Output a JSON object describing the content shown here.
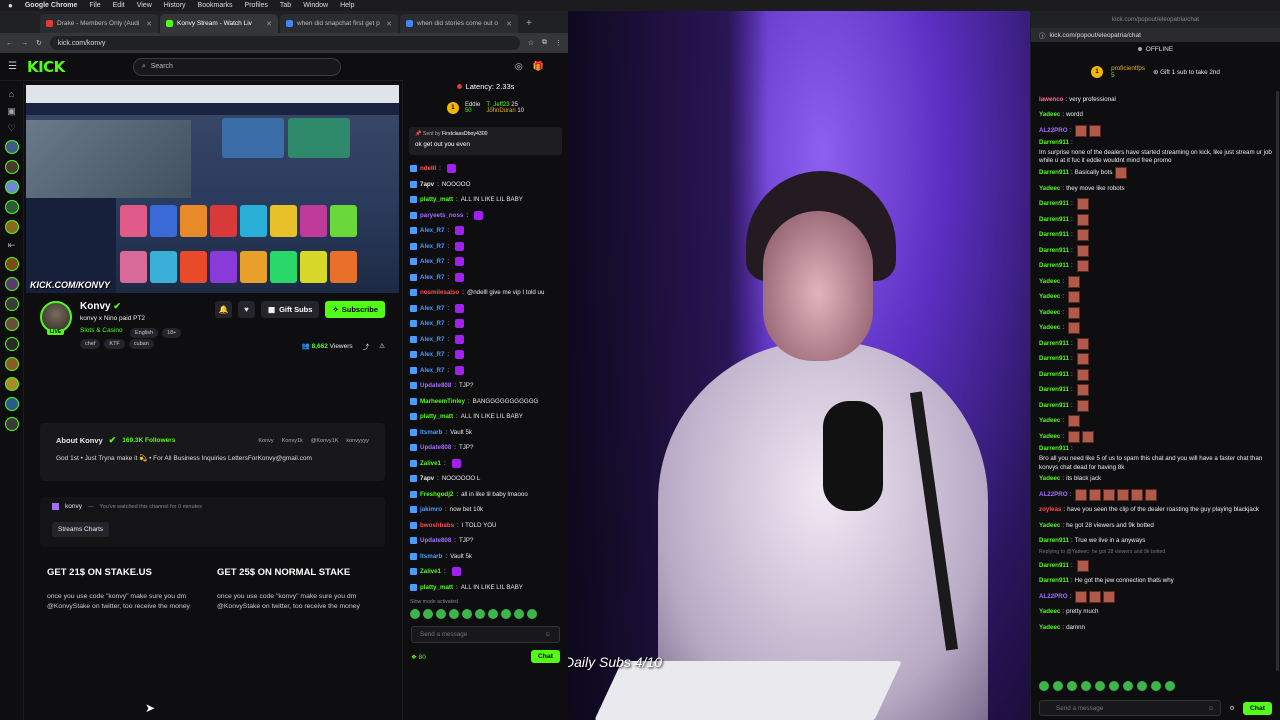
{
  "menubar": {
    "apple": "",
    "app": "Google Chrome",
    "items": [
      "File",
      "Edit",
      "View",
      "History",
      "Bookmarks",
      "Profiles",
      "Tab",
      "Window",
      "Help"
    ]
  },
  "tabs": [
    {
      "label": "Drake - Members Only (Audi",
      "color": "#e53935",
      "active": false
    },
    {
      "label": "Konvy Stream - Watch Liv",
      "color": "#53fc18",
      "active": true
    },
    {
      "label": "when did snapchat first get p",
      "color": "#4285f4",
      "active": false
    },
    {
      "label": "when did stories come out o",
      "color": "#4285f4",
      "active": false
    }
  ],
  "new_tab": "+",
  "url": "kick.com/konvy",
  "site": {
    "logo": "KICK",
    "logo_badge": "BETA",
    "search_placeholder": "Search",
    "player_watermark": "KICK.COM/KONVY",
    "channel": {
      "name": "Konvy",
      "title": "konvy x Nino paid PT2",
      "category": "Slots & Casino",
      "tags": [
        "English",
        "18+",
        "chef",
        "KTF",
        "cuban"
      ],
      "live": "LIVE",
      "gift_label": "Gift Subs",
      "subscribe_label": "Subscribe",
      "viewers_count": "8,662",
      "viewers_label": "Viewers"
    },
    "about": {
      "heading": "About Konvy",
      "followers": "169.3K Followers",
      "socials": [
        "Konvy",
        "Konvy1k",
        "@Konvy1K",
        "konvyyyy"
      ],
      "bio": "God 1st • Just Tryna make it 💫 • For All Business Inquiries LettersForKonvy@gmail.com"
    },
    "watched": {
      "name": "konvy",
      "dash": "—",
      "note": "You've watched this channel for 0 minutes",
      "button": "Streams Charts"
    },
    "promos": [
      {
        "title": "GET 21$ ON STAKE.US",
        "body": "once you use code \"konvy\" make sure you dm @KonvyStake on twitter, too receive the money"
      },
      {
        "title": "GET 25$ ON NORMAL STAKE",
        "body": "once you use code \"konvy\" make sure you dm @KonvyStake on twitter, too receive the money"
      }
    ]
  },
  "left_chat": {
    "latency": "Latency: 2.33s",
    "leaders": [
      {
        "name": "Eddie",
        "value": "50"
      },
      {
        "name": "T_Jeff23",
        "value": "25"
      },
      {
        "name": "JohnDuran",
        "value": "10"
      }
    ],
    "pinned_by": "Sent by",
    "pinned_user": "FirstclassDboy4300",
    "pinned_msg": "ok get out you even",
    "lines": [
      {
        "user": "ndelll",
        "color": "#ff5a5a",
        "text": "",
        "emote": true
      },
      {
        "user": "7apv",
        "color": "#e8e8e8",
        "text": "NOOOOO",
        "emote": false
      },
      {
        "user": "platty_matt",
        "color": "#53fc18",
        "text": "ALL IN LIKE LIL BABY",
        "emote": false
      },
      {
        "user": "paryeets_noss",
        "color": "#a46cff",
        "text": "",
        "emote": true
      },
      {
        "user": "Alex_R7",
        "color": "#4a9cff",
        "text": "",
        "emote": true
      },
      {
        "user": "Alex_R7",
        "color": "#4a9cff",
        "text": "",
        "emote": true
      },
      {
        "user": "Alex_R7",
        "color": "#4a9cff",
        "text": "",
        "emote": true
      },
      {
        "user": "Alex_R7",
        "color": "#4a9cff",
        "text": "",
        "emote": true
      },
      {
        "user": "nosmilesalso",
        "color": "#ff4d4d",
        "text": "@ndelll give me vip I told uu",
        "emote": false
      },
      {
        "user": "Alex_R7",
        "color": "#4a9cff",
        "text": "",
        "emote": true
      },
      {
        "user": "Alex_R7",
        "color": "#4a9cff",
        "text": "",
        "emote": true
      },
      {
        "user": "Alex_R7",
        "color": "#4a9cff",
        "text": "",
        "emote": true
      },
      {
        "user": "Alex_R7",
        "color": "#4a9cff",
        "text": "",
        "emote": true
      },
      {
        "user": "Alex_R7",
        "color": "#4a9cff",
        "text": "",
        "emote": true
      },
      {
        "user": "Update808",
        "color": "#a46cff",
        "text": "TJP?",
        "emote": false
      },
      {
        "user": "MarheemTinley",
        "color": "#53fc18",
        "text": "BANGGGGGGGGGGG",
        "emote": false
      },
      {
        "user": "platty_matt",
        "color": "#53fc18",
        "text": "ALL IN LIKE LIL BABY",
        "emote": false
      },
      {
        "user": "Itsmarb",
        "color": "#4a9cff",
        "text": "Vault 5k",
        "emote": false
      },
      {
        "user": "Update808",
        "color": "#a46cff",
        "text": "TJP?",
        "emote": false
      },
      {
        "user": "Zalive1",
        "color": "#53fc18",
        "text": "",
        "emote": true
      },
      {
        "user": "7apv",
        "color": "#e8e8e8",
        "text": "NOOOOOO L",
        "emote": false
      },
      {
        "user": "Freshgodj2",
        "color": "#53fc18",
        "text": "all in like lil baby lmaooo",
        "emote": false
      },
      {
        "user": "jakimro",
        "color": "#4a9cff",
        "text": "now bet 10k",
        "emote": false
      },
      {
        "user": "bwoshbabs",
        "color": "#ff4d4d",
        "text": "I TOLD YOU",
        "emote": false
      },
      {
        "user": "Update808",
        "color": "#a46cff",
        "text": "TJP?",
        "emote": false
      },
      {
        "user": "Itsmarb",
        "color": "#4a9cff",
        "text": "Vault 5k",
        "emote": false
      },
      {
        "user": "Zalive1",
        "color": "#53fc18",
        "text": "",
        "emote": true
      },
      {
        "user": "platty_matt",
        "color": "#53fc18",
        "text": "ALL IN LIKE LIL BABY",
        "emote": false
      }
    ],
    "slow_mode": "Slow mode activated",
    "input_placeholder": "Send a message",
    "points": "80",
    "chat_button": "Chat"
  },
  "webcam": {
    "overlay": "Daily Subs 4/10"
  },
  "popout": {
    "title": "kick.com/popout/eleopatria/chat",
    "url": "kick.com/popout/eleopatria/chat",
    "status": "OFFLINE",
    "leader_name": "proficientfps",
    "leader_value": "5",
    "gift_label": "Gift 1 sub to take 2nd",
    "lines": [
      {
        "user": "lawenco",
        "color": "#ff6a9a",
        "text": "very professional",
        "boxes": 0
      },
      {
        "user": "Yadeec",
        "color": "#53fc18",
        "text": "wordd",
        "boxes": 0
      },
      {
        "user": "AL22PRO",
        "color": "#a46cff",
        "text": "",
        "boxes": 2
      },
      {
        "user": "Darren911",
        "color": "#53fc18",
        "text": "Im surprise none of the dealers have started streaming on kick, like just stream ur job while u at it fuc it eddie wouldnt mind free promo",
        "boxes": 0
      },
      {
        "user": "Darren911",
        "color": "#53fc18",
        "text": "Basically bots",
        "boxes": 1
      },
      {
        "user": "Yadeec",
        "color": "#53fc18",
        "text": "they move like robots",
        "boxes": 0
      },
      {
        "user": "Darren911",
        "color": "#53fc18",
        "text": "",
        "boxes": 1
      },
      {
        "user": "Darren911",
        "color": "#53fc18",
        "text": "",
        "boxes": 1
      },
      {
        "user": "Darren911",
        "color": "#53fc18",
        "text": "",
        "boxes": 1
      },
      {
        "user": "Darren911",
        "color": "#53fc18",
        "text": "",
        "boxes": 1
      },
      {
        "user": "Darren911",
        "color": "#53fc18",
        "text": "",
        "boxes": 1
      },
      {
        "user": "Yadeec",
        "color": "#53fc18",
        "text": "",
        "boxes": 1
      },
      {
        "user": "Yadeec",
        "color": "#53fc18",
        "text": "",
        "boxes": 1
      },
      {
        "user": "Yadeec",
        "color": "#53fc18",
        "text": "",
        "boxes": 1
      },
      {
        "user": "Yadeec",
        "color": "#53fc18",
        "text": "",
        "boxes": 1
      },
      {
        "user": "Darren911",
        "color": "#53fc18",
        "text": "",
        "boxes": 1
      },
      {
        "user": "Darren911",
        "color": "#53fc18",
        "text": "",
        "boxes": 1
      },
      {
        "user": "Darren911",
        "color": "#53fc18",
        "text": "",
        "boxes": 1
      },
      {
        "user": "Darren911",
        "color": "#53fc18",
        "text": "",
        "boxes": 1
      },
      {
        "user": "Darren911",
        "color": "#53fc18",
        "text": "",
        "boxes": 1
      },
      {
        "user": "Yadeec",
        "color": "#53fc18",
        "text": "",
        "boxes": 1
      },
      {
        "user": "Yadeec",
        "color": "#53fc18",
        "text": "",
        "boxes": 2
      },
      {
        "user": "Darren911",
        "color": "#53fc18",
        "text": "Bro all you need like 5 of us to spam this chat and you will have a faster chat than konvys chat dead for having 8k",
        "boxes": 0
      },
      {
        "user": "Yadeec",
        "color": "#53fc18",
        "text": "its black jack",
        "boxes": 0
      },
      {
        "user": "AL22PRO",
        "color": "#a46cff",
        "text": "",
        "boxes": 6
      },
      {
        "user": "zoyleas",
        "color": "#ff4d4d",
        "text": "have you seen the clip of the dealer roasting the guy playing blackjack",
        "boxes": 0
      },
      {
        "user": "Yadeec",
        "color": "#53fc18",
        "text": "he got 28 viewers and 9k botted",
        "boxes": 0
      },
      {
        "user": "Darren911",
        "color": "#53fc18",
        "text": "True we live in a anyways",
        "boxes": 0
      },
      {
        "user": "Darren911",
        "color": "#53fc18",
        "text": "",
        "boxes": 1
      },
      {
        "user": "Darren911",
        "color": "#53fc18",
        "text": "He got the jew connection thats why",
        "boxes": 0
      },
      {
        "user": "AL22PRO",
        "color": "#a46cff",
        "text": "",
        "boxes": 3
      },
      {
        "user": "Yadeec",
        "color": "#53fc18",
        "text": "pretty much",
        "boxes": 0
      },
      {
        "user": "Yadeec",
        "color": "#53fc18",
        "text": "damnn",
        "boxes": 0
      }
    ],
    "reply_note": "Replying to @Yadeec: he got 28 viewers and 9k botted",
    "input_placeholder": "Send a message",
    "chat_button": "Chat"
  }
}
